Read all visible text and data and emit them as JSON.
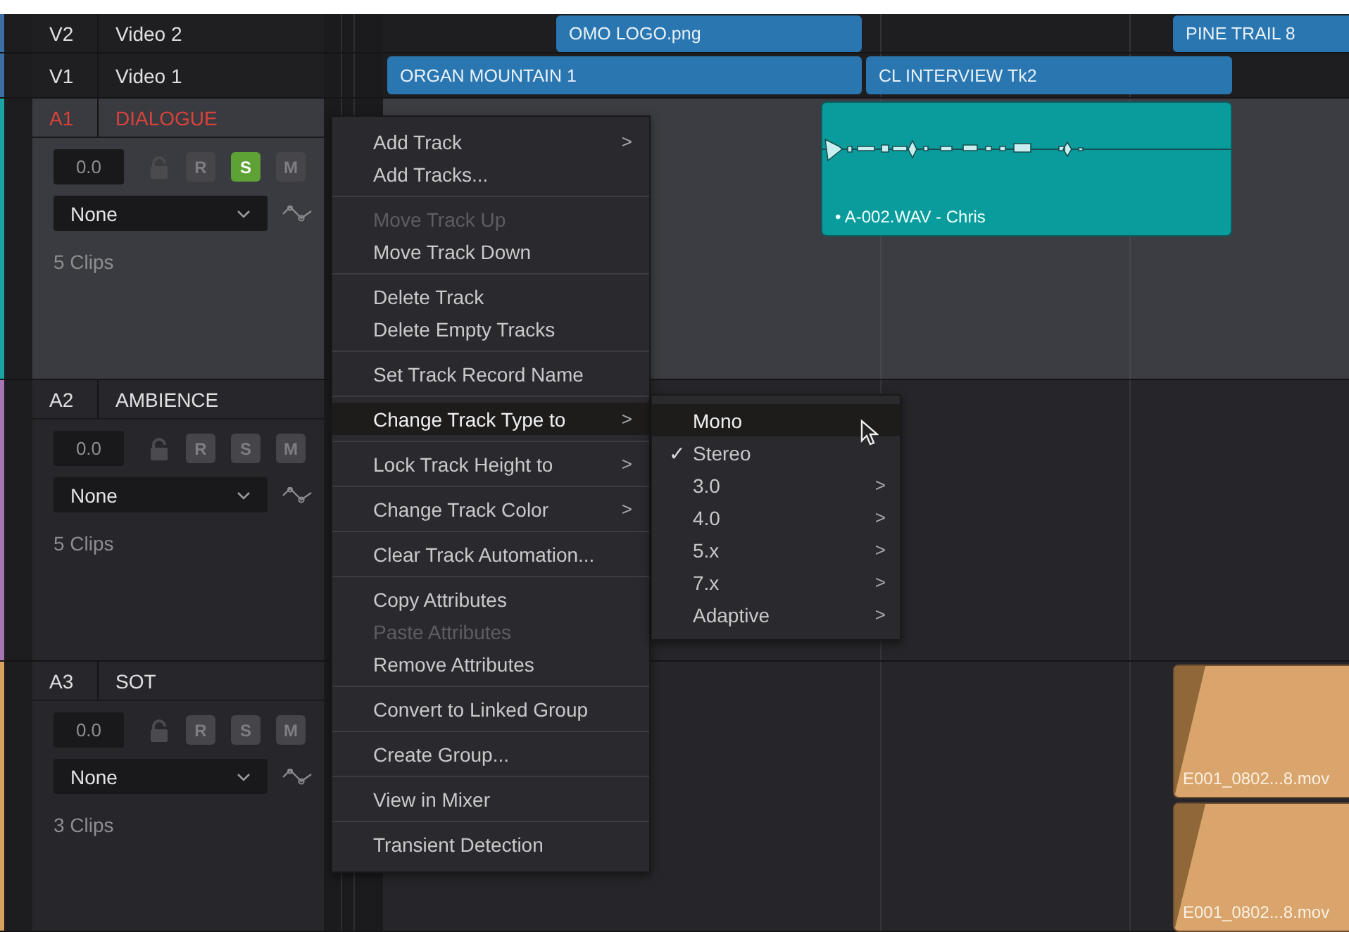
{
  "tracks": [
    {
      "kind": "video",
      "id": "V2",
      "name": "Video 2",
      "color": "#3b6fa8",
      "selected": false,
      "clips": [
        {
          "label": "OMO LOGO.png"
        },
        {
          "label": "PINE TRAIL 8"
        }
      ]
    },
    {
      "kind": "video",
      "id": "V1",
      "name": "Video 1",
      "color": "#3b6fa8",
      "selected": false,
      "clips": [
        {
          "label": "ORGAN MOUNTAIN 1"
        },
        {
          "label": "CL INTERVIEW Tk2"
        }
      ]
    },
    {
      "kind": "audio",
      "id": "A1",
      "name": "DIALOGUE",
      "color": "#1aa3a3",
      "selected": true,
      "volume": "0.0",
      "buttons": [
        {
          "kind": "record",
          "label": "R",
          "on": false
        },
        {
          "kind": "solo",
          "label": "S",
          "on": true
        },
        {
          "kind": "mute",
          "label": "M",
          "on": false
        }
      ],
      "dropdown": "None",
      "clip_count": "5 Clips",
      "clips": [
        {
          "label": "• A-002.WAV - Chris"
        }
      ]
    },
    {
      "kind": "audio",
      "id": "A2",
      "name": "AMBIENCE",
      "color": "#a774b4",
      "selected": false,
      "volume": "0.0",
      "buttons": [
        {
          "kind": "record",
          "label": "R",
          "on": false
        },
        {
          "kind": "solo",
          "label": "S",
          "on": false
        },
        {
          "kind": "mute",
          "label": "M",
          "on": false
        }
      ],
      "dropdown": "None",
      "clip_count": "5 Clips"
    },
    {
      "kind": "audio",
      "id": "A3",
      "name": "SOT",
      "color": "#d9a160",
      "selected": false,
      "volume": "0.0",
      "buttons": [
        {
          "kind": "record",
          "label": "R",
          "on": false
        },
        {
          "kind": "solo",
          "label": "S",
          "on": false
        },
        {
          "kind": "mute",
          "label": "M",
          "on": false
        }
      ],
      "dropdown": "None",
      "clip_count": "3 Clips",
      "clips": [
        {
          "label": "E001_0802...8.mov"
        },
        {
          "label": "E001_0802...8.mov"
        }
      ]
    }
  ],
  "context_menu": {
    "groups": [
      [
        {
          "label": "Add Track",
          "chevron": ">",
          "disabled": false,
          "selected": false
        },
        {
          "label": "Add Tracks...",
          "disabled": false,
          "selected": false
        }
      ],
      [
        {
          "label": "Move Track Up",
          "disabled": true,
          "selected": false
        },
        {
          "label": "Move Track Down",
          "disabled": false,
          "selected": false
        }
      ],
      [
        {
          "label": "Delete Track",
          "disabled": false,
          "selected": false
        },
        {
          "label": "Delete Empty Tracks",
          "disabled": false,
          "selected": false
        }
      ],
      [
        {
          "label": "Set Track Record Name",
          "disabled": false,
          "selected": false
        }
      ],
      [
        {
          "label": "Change Track Type to",
          "chevron": ">",
          "disabled": false,
          "selected": true
        }
      ],
      [
        {
          "label": "Lock Track Height to",
          "chevron": ">",
          "disabled": false,
          "selected": false
        }
      ],
      [
        {
          "label": "Change Track Color",
          "chevron": ">",
          "disabled": false,
          "selected": false
        }
      ],
      [
        {
          "label": "Clear Track Automation...",
          "disabled": false,
          "selected": false
        }
      ],
      [
        {
          "label": "Copy Attributes",
          "disabled": false,
          "selected": false
        },
        {
          "label": "Paste Attributes",
          "disabled": true,
          "selected": false
        },
        {
          "label": "Remove Attributes",
          "disabled": false,
          "selected": false
        }
      ],
      [
        {
          "label": "Convert to Linked Group",
          "disabled": false,
          "selected": false
        }
      ],
      [
        {
          "label": "Create Group...",
          "disabled": false,
          "selected": false
        }
      ],
      [
        {
          "label": "View in Mixer",
          "disabled": false,
          "selected": false
        }
      ],
      [
        {
          "label": "Transient Detection",
          "disabled": false,
          "selected": false
        }
      ]
    ],
    "submenu": [
      {
        "label": "Mono",
        "checked": false,
        "selected": true
      },
      {
        "label": "Stereo",
        "checked": true,
        "selected": false
      },
      {
        "label": "3.0",
        "chevron": ">",
        "checked": false,
        "selected": false
      },
      {
        "label": "4.0",
        "chevron": ">",
        "checked": false,
        "selected": false
      },
      {
        "label": "5.x",
        "chevron": ">",
        "checked": false,
        "selected": false
      },
      {
        "label": "7.x",
        "chevron": ">",
        "checked": false,
        "selected": false
      },
      {
        "label": "Adaptive",
        "chevron": ">",
        "checked": false,
        "selected": false
      }
    ],
    "check_mark": "✓"
  }
}
